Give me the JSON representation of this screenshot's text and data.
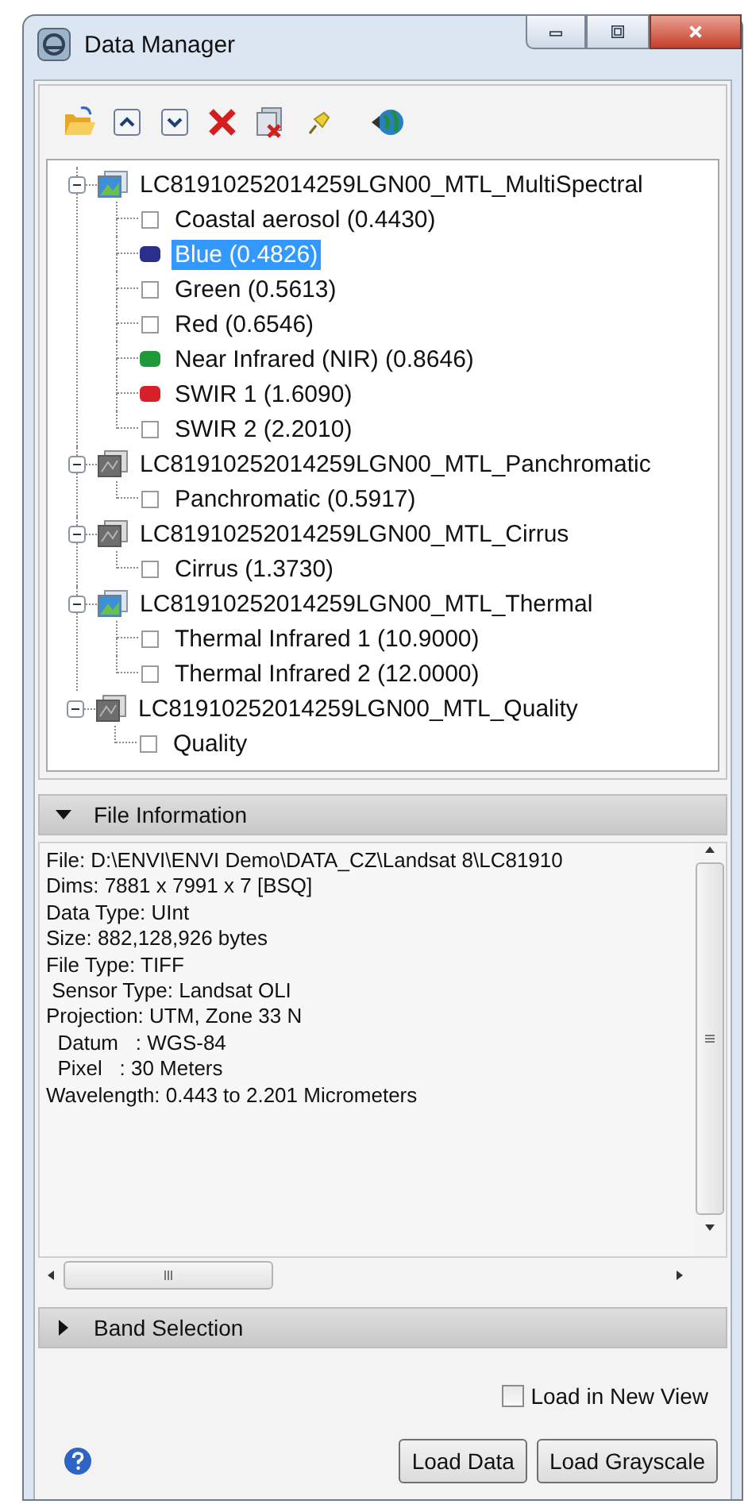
{
  "window": {
    "title": "Data Manager"
  },
  "tree": [
    {
      "label": "LC81910252014259LGN00_MTL_MultiSpectral",
      "kind": "color",
      "expanded": true,
      "children": [
        {
          "label": "Coastal aerosol (0.4430)",
          "kind": "checkbox",
          "checked": false,
          "selected": false
        },
        {
          "label": "Blue (0.4826)",
          "kind": "swatch",
          "color": "#2a2f8c",
          "selected": true
        },
        {
          "label": "Green (0.5613)",
          "kind": "checkbox",
          "checked": false,
          "selected": false
        },
        {
          "label": "Red (0.6546)",
          "kind": "checkbox",
          "checked": false,
          "selected": false
        },
        {
          "label": "Near Infrared (NIR) (0.8646)",
          "kind": "swatch",
          "color": "#1f9a3a",
          "selected": false
        },
        {
          "label": "SWIR 1 (1.6090)",
          "kind": "swatch",
          "color": "#d8202a",
          "selected": false
        },
        {
          "label": "SWIR 2 (2.2010)",
          "kind": "checkbox",
          "checked": false,
          "selected": false
        }
      ]
    },
    {
      "label": "LC81910252014259LGN00_MTL_Panchromatic",
      "kind": "gray",
      "expanded": true,
      "children": [
        {
          "label": "Panchromatic (0.5917)",
          "kind": "checkbox",
          "checked": false,
          "selected": false
        }
      ]
    },
    {
      "label": "LC81910252014259LGN00_MTL_Cirrus",
      "kind": "gray",
      "expanded": true,
      "children": [
        {
          "label": "Cirrus (1.3730)",
          "kind": "checkbox",
          "checked": false,
          "selected": false
        }
      ]
    },
    {
      "label": "LC81910252014259LGN00_MTL_Thermal",
      "kind": "color",
      "expanded": true,
      "children": [
        {
          "label": "Thermal Infrared 1 (10.9000)",
          "kind": "checkbox",
          "checked": false,
          "selected": false
        },
        {
          "label": "Thermal Infrared 2 (12.0000)",
          "kind": "checkbox",
          "checked": false,
          "selected": false
        }
      ]
    },
    {
      "label": "LC81910252014259LGN00_MTL_Quality",
      "kind": "gray",
      "expanded": true,
      "children": [
        {
          "label": "Quality",
          "kind": "checkbox",
          "checked": false,
          "selected": false
        }
      ]
    }
  ],
  "file_information": {
    "title": "File Information",
    "expanded": true,
    "lines": [
      "File: D:\\ENVI\\ENVI Demo\\DATA_CZ\\Landsat 8\\LC81910",
      "Dims: 7881 x 7991 x 7 [BSQ]",
      "Data Type: UInt",
      "Size: 882,128,926 bytes",
      "File Type: TIFF",
      " Sensor Type: Landsat OLI",
      "Projection: UTM, Zone 33 N",
      "  Datum   : WGS-84",
      "  Pixel   : 30 Meters",
      "Wavelength: 0.443 to 2.201 Micrometers"
    ]
  },
  "band_selection": {
    "title": "Band Selection",
    "expanded": false
  },
  "load_in_new_view": {
    "label": "Load in New View",
    "checked": false
  },
  "buttons": [
    "Load Data",
    "Load Grayscale"
  ]
}
